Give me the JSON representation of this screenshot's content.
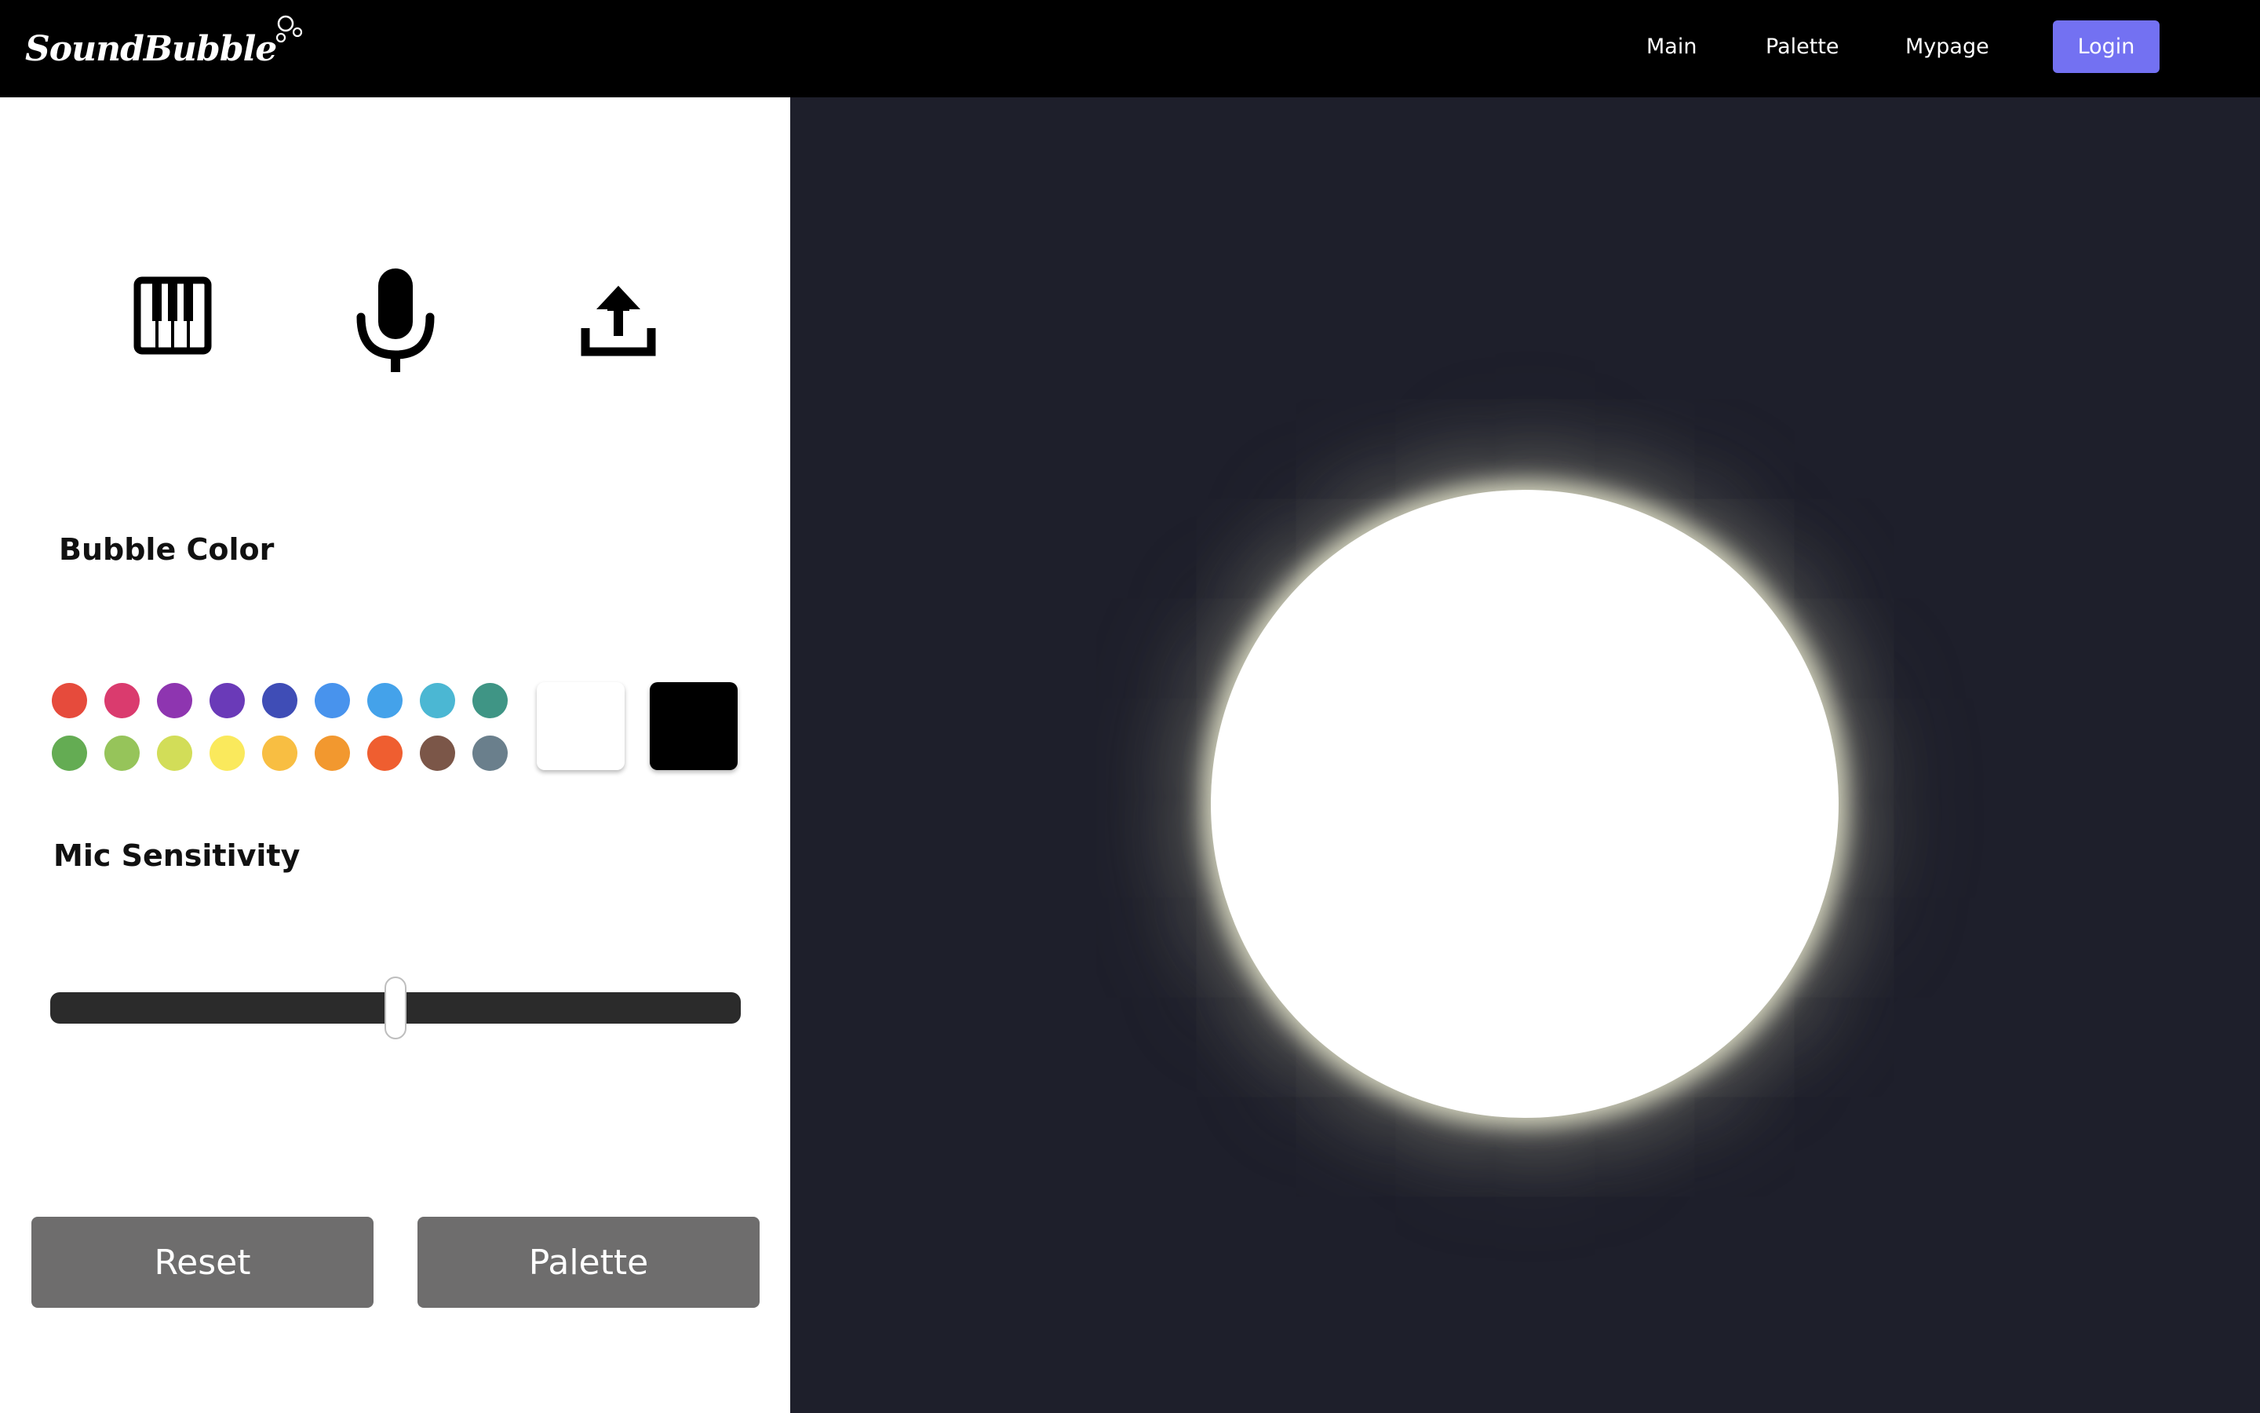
{
  "header": {
    "logo_text": "SoundBubble",
    "nav": [
      {
        "label": "Main"
      },
      {
        "label": "Palette"
      },
      {
        "label": "Mypage"
      }
    ],
    "login_label": "Login"
  },
  "modes": [
    {
      "icon": "piano-icon"
    },
    {
      "icon": "microphone-icon"
    },
    {
      "icon": "upload-icon"
    }
  ],
  "bubble_color": {
    "label": "Bubble Color",
    "swatches_row1": [
      "#e64b3c",
      "#da3b6e",
      "#8e35b0",
      "#6a3ab8",
      "#3f4db6",
      "#4893ed",
      "#44a2ea",
      "#4bb7d3",
      "#3f9585"
    ],
    "swatches_row2": [
      "#64ac53",
      "#96c45a",
      "#d2dd58",
      "#fae95c",
      "#f8be42",
      "#f2982f",
      "#ef5e30",
      "#7b5648",
      "#6a7f8c"
    ],
    "large_swatches": [
      "#ffffff",
      "#000000"
    ],
    "selected": "#ffffff"
  },
  "mic_sensitivity": {
    "label": "Mic Sensitivity",
    "value": 0.5
  },
  "actions": {
    "reset_label": "Reset",
    "palette_label": "Palette"
  },
  "visualizer": {
    "bubble_color": "#ffffff",
    "background": "#1e1f2b"
  }
}
